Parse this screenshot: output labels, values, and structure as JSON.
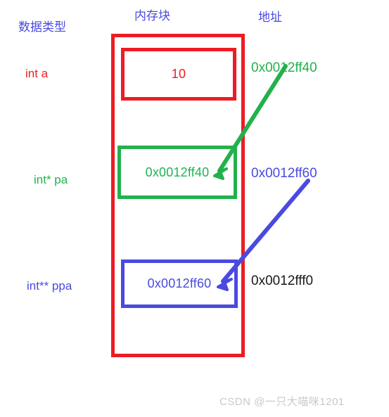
{
  "headers": {
    "datatype": "数据类型",
    "memory_block": "内存块",
    "address": "地址"
  },
  "colors": {
    "red": "#ed1c24",
    "green": "#22b14c",
    "blue": "#4a4ae0",
    "black": "#1a1a1a",
    "watermark_gray": "#c9c9c9"
  },
  "rows": [
    {
      "type_label": "int    a",
      "cell_value": "10",
      "address": "0x0012ff40",
      "type_color": "#ed1c24",
      "cell_color": "#ed1c24",
      "address_color": "#22b14c"
    },
    {
      "type_label": "int* pa",
      "cell_value": "0x0012ff40",
      "address": "0x0012ff60",
      "type_color": "#22b14c",
      "cell_color": "#22b14c",
      "address_color": "#4a4ae0"
    },
    {
      "type_label": "int** ppa",
      "cell_value": "0x0012ff60",
      "address": "0x0012fff0",
      "type_color": "#4a4ae0",
      "cell_color": "#4a4ae0",
      "address_color": "#1a1a1a"
    }
  ],
  "arrows": [
    {
      "name": "green-pointer-arrow",
      "color": "#22b14c",
      "from": "0x0012ff40 address label",
      "to": "pa cell value"
    },
    {
      "name": "blue-pointer-arrow",
      "color": "#4a4ae0",
      "from": "0x0012ff60 address label",
      "to": "ppa cell value"
    }
  ],
  "watermark": "CSDN @一只大喵咪1201"
}
